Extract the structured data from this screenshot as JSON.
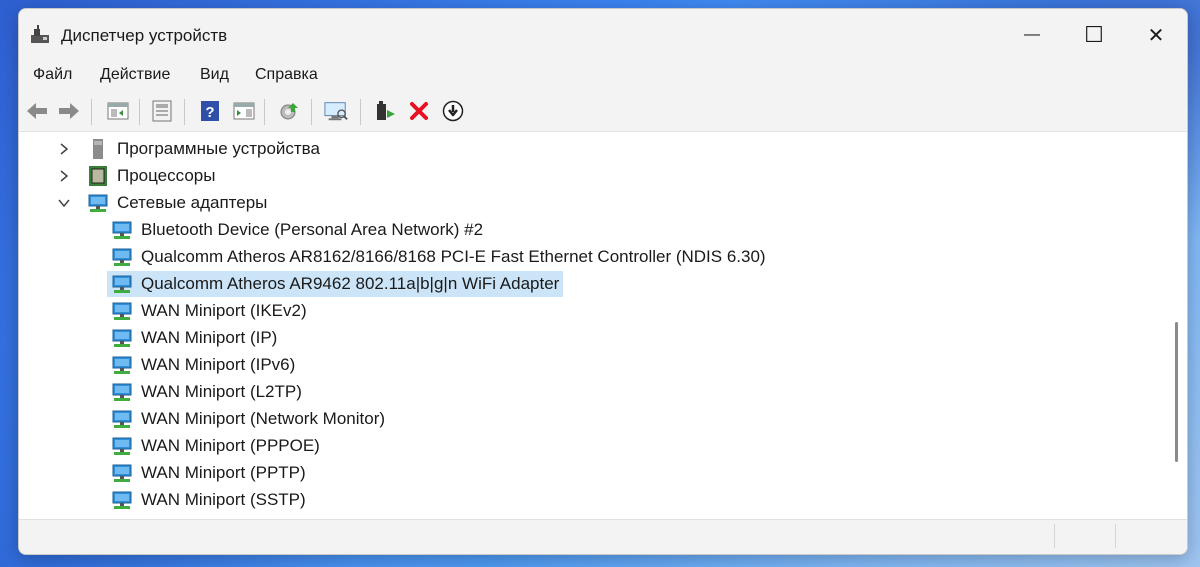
{
  "window": {
    "title": "Диспетчер устройств",
    "minimize_glyph": "—",
    "maximize_glyph": "☐",
    "close_glyph": "✕"
  },
  "menu": [
    "Файл",
    "Действие",
    "Вид",
    "Справка"
  ],
  "toolbar": {
    "icons": [
      "back-icon",
      "forward-icon",
      "show-hide-tree-icon",
      "properties-icon",
      "help-icon",
      "action-pane-icon",
      "update-driver-icon",
      "scan-hardware-icon",
      "enable-device-icon",
      "uninstall-device-icon",
      "disable-device-icon"
    ]
  },
  "tree": {
    "categories": [
      {
        "label": "Программные устройства",
        "expanded": false,
        "icon": "software-device-icon"
      },
      {
        "label": "Процессоры",
        "expanded": false,
        "icon": "processor-icon"
      },
      {
        "label": "Сетевые адаптеры",
        "expanded": true,
        "icon": "network-adapter-icon"
      }
    ],
    "devices": [
      {
        "label": "Bluetooth Device (Personal Area Network) #2",
        "selected": false
      },
      {
        "label": "Qualcomm Atheros AR8162/8166/8168 PCI-E Fast Ethernet Controller (NDIS 6.30)",
        "selected": false
      },
      {
        "label": "Qualcomm Atheros AR9462 802.11a|b|g|n WiFi Adapter",
        "selected": true
      },
      {
        "label": "WAN Miniport (IKEv2)",
        "selected": false
      },
      {
        "label": "WAN Miniport (IP)",
        "selected": false
      },
      {
        "label": "WAN Miniport (IPv6)",
        "selected": false
      },
      {
        "label": "WAN Miniport (L2TP)",
        "selected": false
      },
      {
        "label": "WAN Miniport (Network Monitor)",
        "selected": false
      },
      {
        "label": "WAN Miniport (PPPOE)",
        "selected": false
      },
      {
        "label": "WAN Miniport (PPTP)",
        "selected": false
      },
      {
        "label": "WAN Miniport (SSTP)",
        "selected": false
      }
    ]
  },
  "colors": {
    "selection": "#cce4f7",
    "accent_red": "#e81123",
    "adapter_blue": "#2f8fd8",
    "adapter_green": "#3fae3f"
  }
}
